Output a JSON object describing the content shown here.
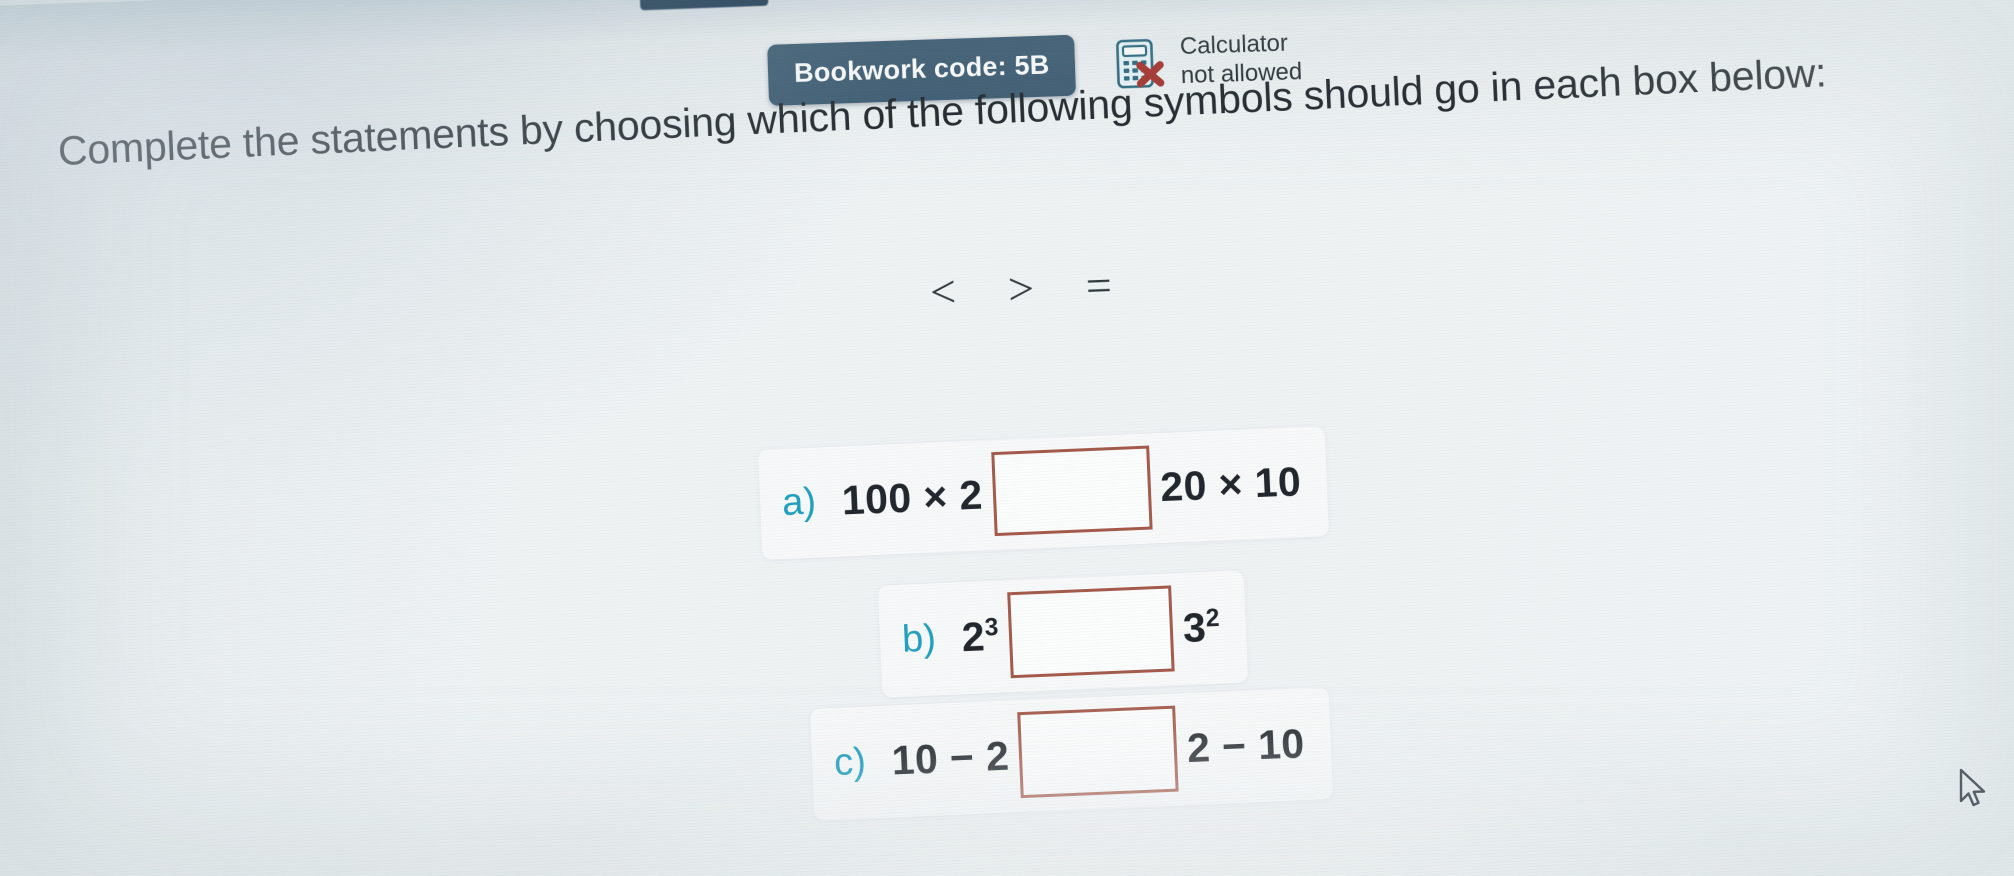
{
  "header": {
    "bookwork_code": "Bookwork code: 5B",
    "calculator_line1": "Calculator",
    "calculator_line2": "not allowed",
    "calculator_icon": "calculator-not-allowed-icon"
  },
  "question": {
    "text": "Complete the statements by choosing which of the following symbols should go in each box below:"
  },
  "symbol_palette": {
    "symbols": [
      "<",
      ">",
      "="
    ]
  },
  "statements": [
    {
      "label": "a)",
      "left_expression": "100 × 2",
      "right_expression": "20 × 10",
      "answer": ""
    },
    {
      "label": "b)",
      "left_base": "2",
      "left_exponent": "3",
      "right_base": "3",
      "right_exponent": "2",
      "answer": ""
    },
    {
      "label": "c)",
      "left_expression": "10 − 2",
      "right_expression": "2 − 10",
      "answer": ""
    }
  ],
  "cursor": {
    "icon": "mouse-pointer-icon"
  },
  "colors": {
    "chip_background": "#3f5d73",
    "chip_text": "#ffffff",
    "label_accent": "#1f9fc0",
    "answer_box_border": "#a45a4b",
    "calculator_icon_outline": "#2e6b80",
    "calculator_cross": "#a8352f",
    "page_background": "#eef2f3",
    "body_text": "#23292e"
  }
}
